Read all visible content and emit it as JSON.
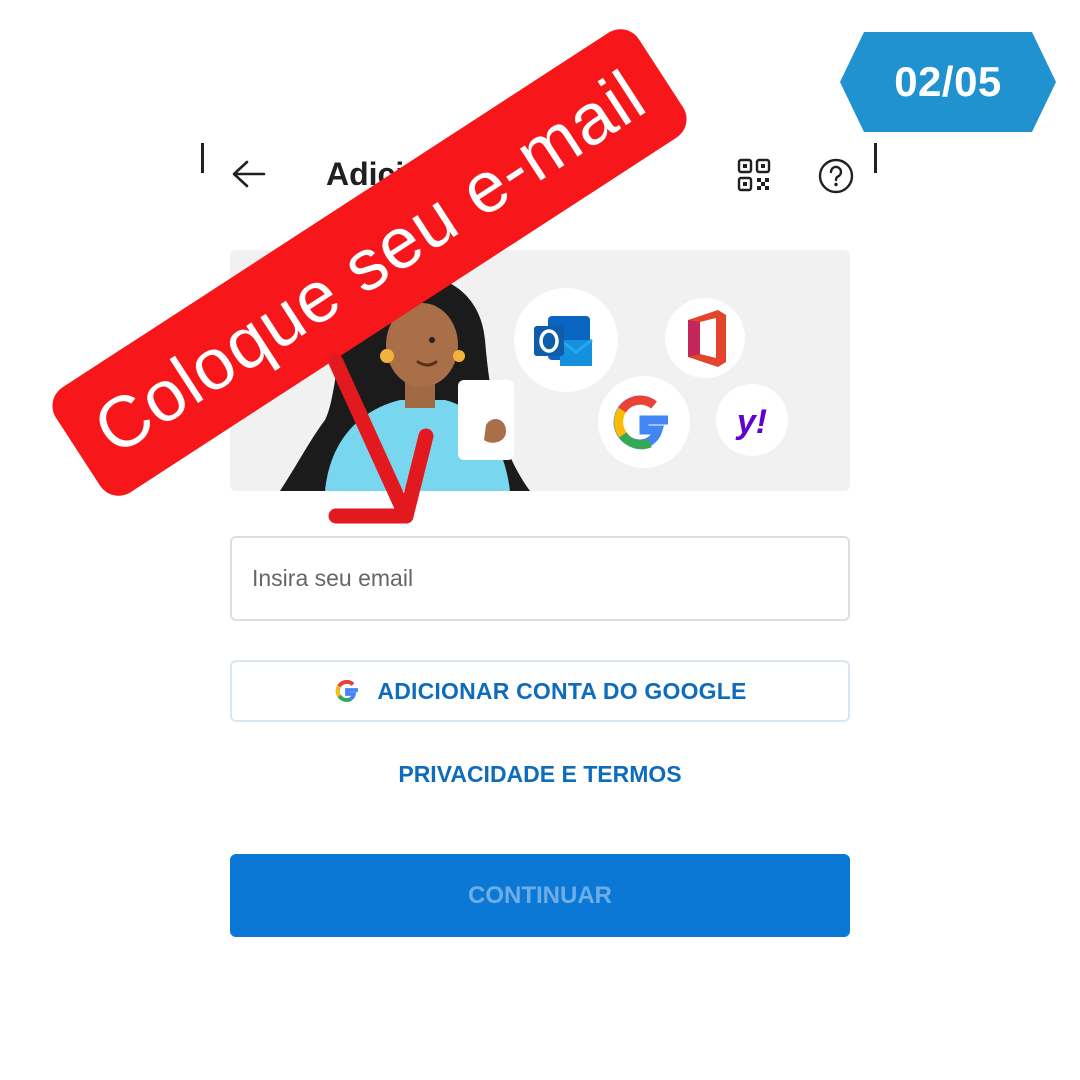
{
  "header": {
    "title": "Adici",
    "back_icon": "arrow-left-icon",
    "qr_icon": "qr-code-icon",
    "help_icon": "help-circle-icon"
  },
  "illustration": {
    "services": [
      "Outlook",
      "Office",
      "Google",
      "Yahoo"
    ],
    "yahoo_logo_text": "y!"
  },
  "email_field": {
    "value": "",
    "placeholder": "Insira seu email"
  },
  "google_button": {
    "label": "ADICIONAR CONTA DO GOOGLE",
    "icon": "google-g-icon"
  },
  "privacy_link": {
    "label": "PRIVACIDADE E TERMOS"
  },
  "continue_button": {
    "label": "CONTINUAR"
  },
  "overlay": {
    "page_indicator": "02/05",
    "banner_text": "Coloque seu e-mail",
    "arrow_icon": "red-down-arrow-icon"
  },
  "colors": {
    "accent_blue": "#0f6cbd",
    "continue_blue": "#0a78d4",
    "badge_blue": "#2192d0",
    "banner_red": "#f7161a"
  }
}
